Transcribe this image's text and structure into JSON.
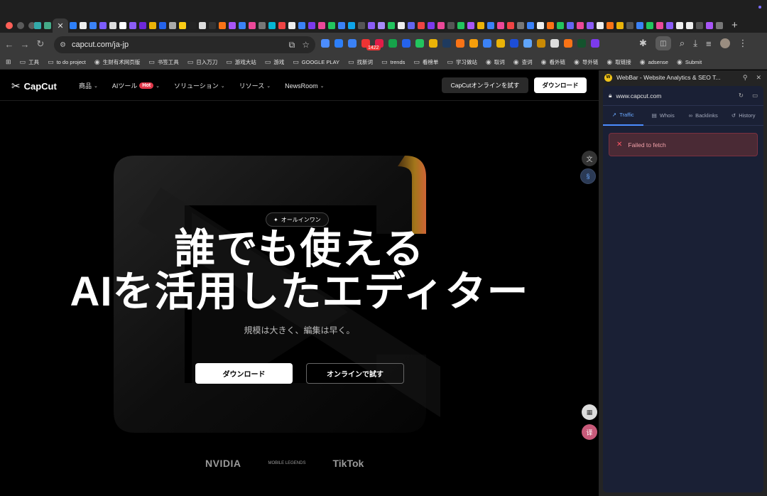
{
  "browser": {
    "active_tab_icon": "close-icon",
    "url": "capcut.com/ja-jp",
    "extension_badge": "1422",
    "bookmarks": [
      "工具",
      "to do project",
      "生财有术网页版",
      "书签工具",
      "日入万刀",
      "游戏大站",
      "游戏",
      "GOOGLE PLAY",
      "找新词",
      "trends",
      "看榜单",
      "学习做站",
      "取词",
      "查词",
      "看外链",
      "导外链",
      "取链接",
      "adsense",
      "Submit"
    ]
  },
  "site": {
    "logo": "CapCut",
    "menu": {
      "products": "商品",
      "ai_tools": "AIツール",
      "hot": "Hot",
      "solutions": "ソリューション",
      "resources": "リソース",
      "newsroom": "NewsRoom"
    },
    "try_online": "CapCutオンラインを試す",
    "download": "ダウンロード",
    "pill": "オールインワン",
    "headline_1": "誰でも使える",
    "headline_2": "AIを活用したエディター",
    "subheadline": "規模は大きく、編集は早く。",
    "cta_download": "ダウンロード",
    "cta_online": "オンラインで試す",
    "partners": [
      "NVIDIA",
      "MOBILE LEGENDS",
      "TikTok"
    ]
  },
  "panel": {
    "title": "WebBar - Website Analytics & SEO T...",
    "site": "www.capcut.com",
    "tabs": [
      "Traffic",
      "Whois",
      "Backlinks",
      "History"
    ],
    "error": "Failed to fetch"
  },
  "colors": {
    "accent": "#4c8dff",
    "hot": "#e0384a",
    "error_bg": "#4a2a35"
  }
}
